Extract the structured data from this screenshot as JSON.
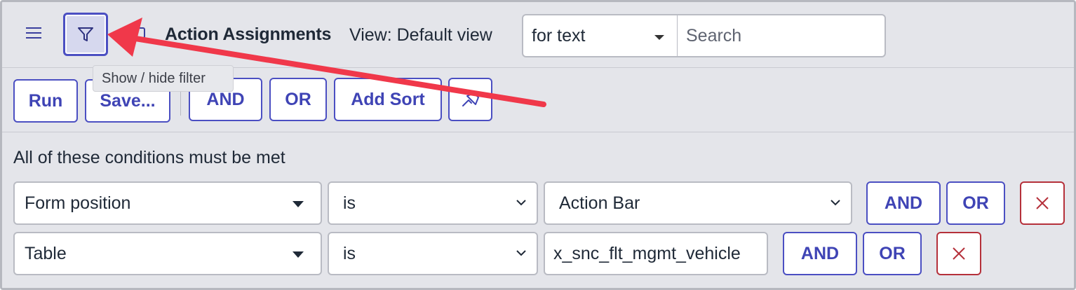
{
  "header": {
    "title": "Action Assignments",
    "view_label": "View: Default view",
    "search_field_select": "for text",
    "search_placeholder": "Search",
    "filter_tooltip": "Show / hide filter"
  },
  "toolbar": {
    "run_label": "Run",
    "save_label": "Save...",
    "and_label": "AND",
    "or_label": "OR",
    "add_sort_label": "Add Sort"
  },
  "conditions": {
    "label": "All of these conditions must be met",
    "rows": [
      {
        "field": "Form position",
        "operator": "is",
        "value": "Action Bar",
        "and_label": "AND",
        "or_label": "OR"
      },
      {
        "field": "Table",
        "operator": "is",
        "value": "x_snc_flt_mgmt_vehicle",
        "and_label": "AND",
        "or_label": "OR"
      }
    ]
  },
  "colors": {
    "accent": "#4b4fc2",
    "danger": "#b5303a",
    "annotation_arrow": "#f0384a",
    "background": "#e4e5ea"
  },
  "icons": [
    "menu-icon",
    "filter-icon",
    "peek-icon",
    "pin-icon",
    "close-icon",
    "caret-down-icon",
    "chevron-down-icon"
  ]
}
